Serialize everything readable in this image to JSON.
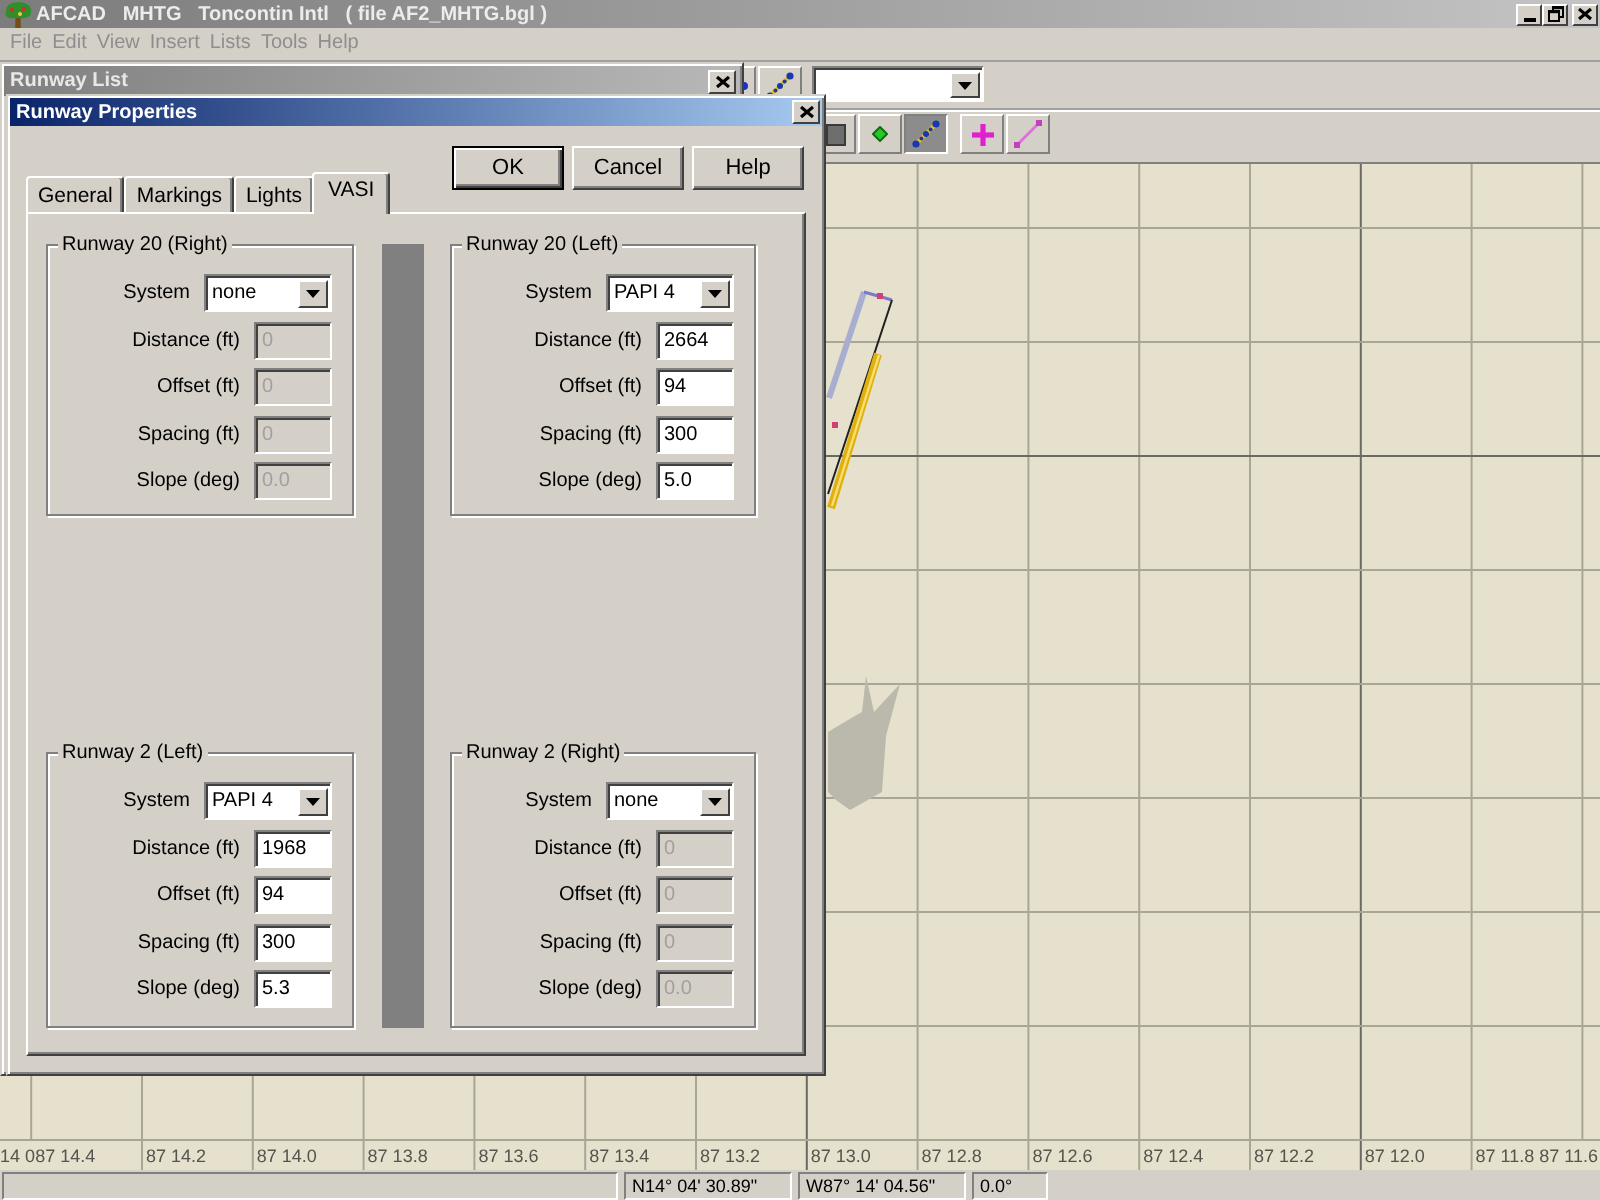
{
  "window": {
    "title": "AFCAD   MHTG   Toncontin Intl   ( file AF2_MHTG.bgl )"
  },
  "menu": [
    {
      "label": "File",
      "disabled": true
    },
    {
      "label": "Edit",
      "disabled": true
    },
    {
      "label": "View",
      "disabled": true
    },
    {
      "label": "Insert",
      "disabled": true
    },
    {
      "label": "Lists",
      "disabled": true
    },
    {
      "label": "Tools",
      "disabled": true
    },
    {
      "label": "Help",
      "disabled": true
    }
  ],
  "toolbars": [
    {
      "items": [
        {
          "kind": "point",
          "pressed": false
        },
        {
          "kind": "path",
          "pressed": false
        },
        {
          "kind": "combo"
        }
      ]
    },
    {
      "items": [
        {
          "kind": "box",
          "pressed": false
        },
        {
          "kind": "diamond",
          "pressed": false
        },
        {
          "kind": "path",
          "pressed": true
        },
        {
          "kind": "spacer"
        },
        {
          "kind": "cross",
          "pressed": false
        },
        {
          "kind": "line",
          "pressed": false
        }
      ]
    }
  ],
  "runway_list": {
    "title": "Runway List"
  },
  "dialog": {
    "title": "Runway Properties",
    "buttons": [
      {
        "label": "OK",
        "default": true
      },
      {
        "label": "Cancel",
        "default": false
      },
      {
        "label": "Help",
        "default": false
      }
    ],
    "tabs": [
      {
        "label": "General",
        "selected": false
      },
      {
        "label": "Markings",
        "selected": false
      },
      {
        "label": "Lights",
        "selected": false
      },
      {
        "label": "VASI",
        "selected": true
      }
    ],
    "groups": [
      {
        "title": "Runway 20 (Right)",
        "system": {
          "label": "System",
          "value": "none"
        },
        "fields": [
          {
            "label": "Distance (ft)",
            "value": "0",
            "disabled": true
          },
          {
            "label": "Offset (ft)",
            "value": "0",
            "disabled": true
          },
          {
            "label": "Spacing (ft)",
            "value": "0",
            "disabled": true
          },
          {
            "label": "Slope (deg)",
            "value": "0.0",
            "disabled": true
          }
        ]
      },
      {
        "title": "Runway 20 (Left)",
        "system": {
          "label": "System",
          "value": "PAPI 4"
        },
        "fields": [
          {
            "label": "Distance (ft)",
            "value": "2664",
            "disabled": false
          },
          {
            "label": "Offset (ft)",
            "value": "94",
            "disabled": false
          },
          {
            "label": "Spacing (ft)",
            "value": "300",
            "disabled": false
          },
          {
            "label": "Slope (deg)",
            "value": "5.0",
            "disabled": false
          }
        ]
      },
      {
        "title": "Runway 2 (Left)",
        "system": {
          "label": "System",
          "value": "PAPI 4"
        },
        "fields": [
          {
            "label": "Distance (ft)",
            "value": "1968",
            "disabled": false
          },
          {
            "label": "Offset (ft)",
            "value": "94",
            "disabled": false
          },
          {
            "label": "Spacing (ft)",
            "value": "300",
            "disabled": false
          },
          {
            "label": "Slope (deg)",
            "value": "5.3",
            "disabled": false
          }
        ]
      },
      {
        "title": "Runway 2 (Right)",
        "system": {
          "label": "System",
          "value": "none"
        },
        "fields": [
          {
            "label": "Distance (ft)",
            "value": "0",
            "disabled": true
          },
          {
            "label": "Offset (ft)",
            "value": "0",
            "disabled": true
          },
          {
            "label": "Spacing (ft)",
            "value": "0",
            "disabled": true
          },
          {
            "label": "Slope (deg)",
            "value": "0.0",
            "disabled": true
          }
        ]
      }
    ]
  },
  "map": {
    "corner_label": "14 0",
    "axis_labels": [
      "87 14.4",
      "87 14.2",
      "87 14.0",
      "87 13.8",
      "87 13.6",
      "87 13.4",
      "87 13.2",
      "87 13.0",
      "87 12.8",
      "87 12.6",
      "87 12.4",
      "87 12.2",
      "87 12.0",
      "87 11.8",
      "87 11.6"
    ]
  },
  "status_bar": {
    "panels": [
      "N14° 04' 30.89\"",
      "W87° 14' 04.56\"",
      "0.0°"
    ]
  }
}
